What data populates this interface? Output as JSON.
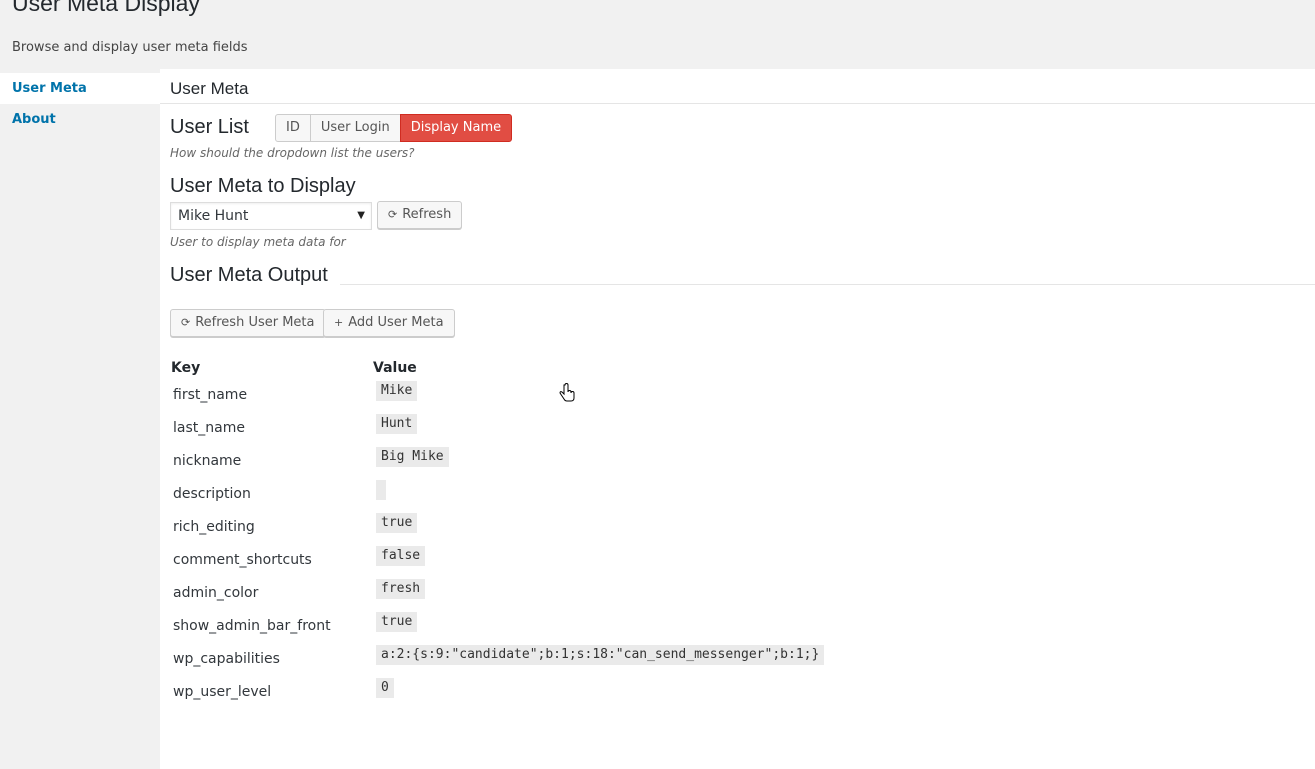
{
  "page": {
    "title": "User Meta Display",
    "subtitle": "Browse and display user meta fields"
  },
  "sidebar": {
    "items": [
      {
        "label": "User Meta",
        "active": true
      },
      {
        "label": "About",
        "active": false
      }
    ]
  },
  "main": {
    "section_title": "User Meta",
    "user_list": {
      "heading": "User List",
      "options": [
        "ID",
        "User Login",
        "Display Name"
      ],
      "selected": "Display Name",
      "help": "How should the dropdown list the users?"
    },
    "meta_display": {
      "heading": "User Meta to Display",
      "selected_user": "Mike Hunt",
      "refresh_label": "Refresh",
      "help": "User to display meta data for"
    },
    "output": {
      "heading": "User Meta Output",
      "refresh_meta_label": "Refresh User Meta",
      "add_meta_label": "Add User Meta",
      "columns": {
        "key": "Key",
        "value": "Value"
      },
      "rows": [
        {
          "key": "first_name",
          "value": "Mike"
        },
        {
          "key": "last_name",
          "value": "Hunt"
        },
        {
          "key": "nickname",
          "value": "Big Mike"
        },
        {
          "key": "description",
          "value": ""
        },
        {
          "key": "rich_editing",
          "value": "true"
        },
        {
          "key": "comment_shortcuts",
          "value": "false"
        },
        {
          "key": "admin_color",
          "value": "fresh"
        },
        {
          "key": "show_admin_bar_front",
          "value": "true"
        },
        {
          "key": "wp_capabilities",
          "value": "a:2:{s:9:\"candidate\";b:1;s:18:\"can_send_messenger\";b:1;}"
        },
        {
          "key": "wp_user_level",
          "value": "0"
        }
      ]
    }
  },
  "colors": {
    "accent": "#e14d43",
    "link": "#0073aa",
    "background": "#f1f1f1"
  }
}
